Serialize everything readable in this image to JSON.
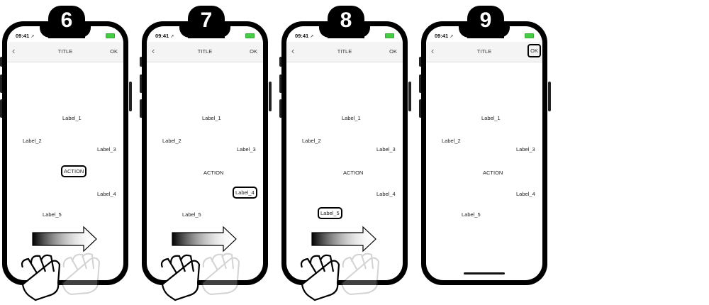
{
  "status": {
    "time": "09:41",
    "location_glyph": "↗"
  },
  "navbar": {
    "back_glyph": "‹",
    "title": "TITLE",
    "ok": "OK"
  },
  "labels": {
    "label_1": "Label_1",
    "label_2": "Label_2",
    "label_3": "Label_3",
    "action": "ACTION",
    "label_4": "Label_4",
    "label_5": "Label_5"
  },
  "steps": [
    {
      "number": "6",
      "highlighted": "action",
      "gesture": "swipe-right"
    },
    {
      "number": "7",
      "highlighted": "label_4",
      "gesture": "swipe-right"
    },
    {
      "number": "8",
      "highlighted": "label_5",
      "gesture": "swipe-right"
    },
    {
      "number": "9",
      "highlighted": "ok",
      "gesture": "none"
    }
  ],
  "colors": {
    "frame": "#000000",
    "navbar_bg": "#f4f4f4",
    "battery": "#44cc44"
  }
}
